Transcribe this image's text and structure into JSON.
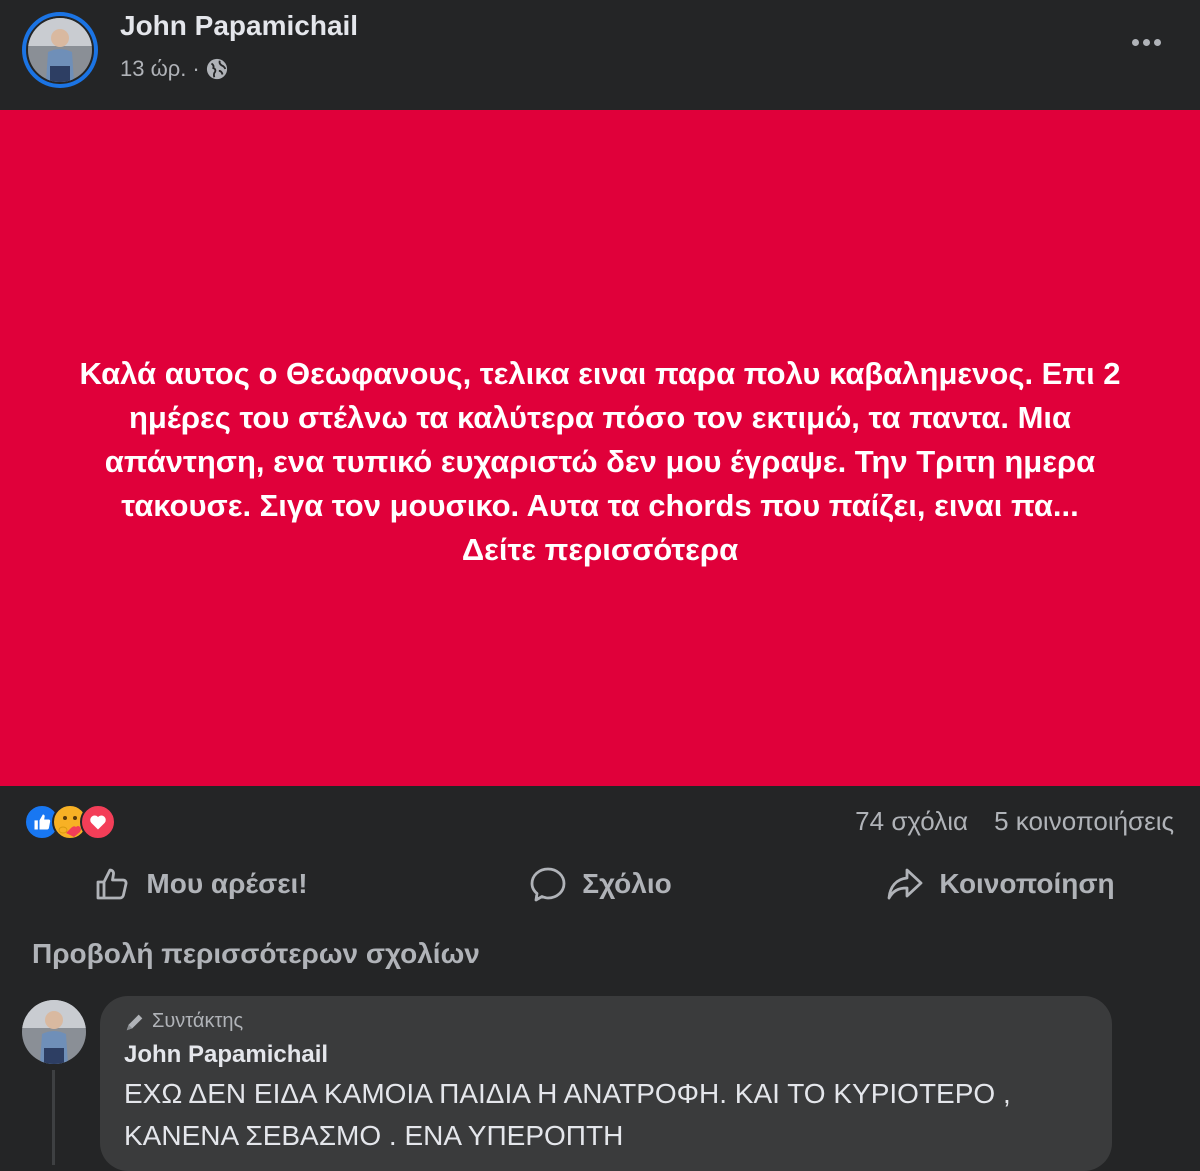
{
  "post": {
    "author": "John Papamichail",
    "time": "13 ώρ.",
    "separator": "·",
    "visibility_icon": "globe-icon",
    "background_color": "#e0003a",
    "text": "Καλά αυτος ο Θεωφανους, τελικα ειναι παρα πολυ καβαλημενος. Επι 2 ημέρες του στέλνω τα καλύτερα πόσο τον εκτιμώ, τα παντα. Μια απάντηση, ενα τυπικό ευχαριστώ δεν μου έγραψε. Την Τριτη ημερα τακουσε. Σιγα τον μουσικο. Αυτα τα chords που παίζει, ειναι πα...",
    "see_more": "Δείτε περισσότερα"
  },
  "reactions": {
    "icons": [
      "like-reaction-icon",
      "care-reaction-icon",
      "love-reaction-icon"
    ],
    "comments_count": "74 σχόλια",
    "shares_count": "5 κοινοποιήσεις"
  },
  "actions": {
    "like": "Μου αρέσει!",
    "comment": "Σχόλιο",
    "share": "Κοινοποίηση"
  },
  "comments": {
    "view_more": "Προβολή περισσότερων σχολίων",
    "items": [
      {
        "badge": "Συντάκτης",
        "author": "John Papamichail",
        "text": "ΕΧΩ ΔΕΝ ΕΙΔΑ ΚΑΜΟΙΑ ΠΑΙΔΙΑ Η ΑΝΑΤΡΟΦΗ. ΚΑΙ ΤΟ ΚΥΡΙΟΤΕΡΟ , ΚΑΝΕΝΑ ΣΕΒΑΣΜΟ . ΕΝΑ ΥΠΕΡΟΠΤΗ"
      }
    ]
  },
  "colors": {
    "background": "#242526",
    "accent": "#1b74e4",
    "bubble": "#3a3b3c"
  }
}
